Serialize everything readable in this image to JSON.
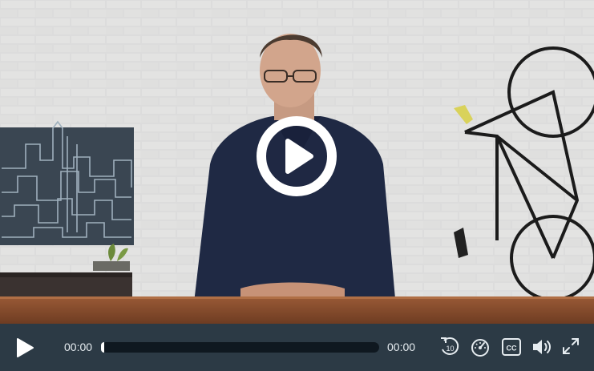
{
  "player": {
    "current_time": "00:00",
    "duration": "00:00",
    "progress_fraction": 0.0,
    "state": "paused",
    "controls": {
      "play_icon": "play-icon",
      "rewind_icon": "rewind-10-icon",
      "rewind_seconds": "10",
      "speed_icon": "playback-speed-icon",
      "captions_icon": "closed-captions-icon",
      "captions_label": "CC",
      "volume_icon": "volume-icon",
      "fullscreen_icon": "fullscreen-icon"
    }
  },
  "colors": {
    "control_bar": "#2c3a45",
    "progress_track": "#0f1820",
    "control_text": "#e6ecf0"
  }
}
